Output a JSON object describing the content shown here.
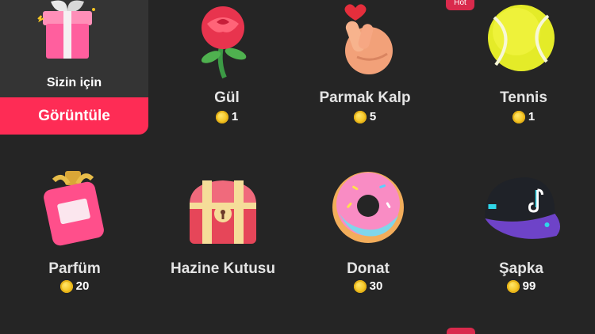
{
  "featured": {
    "caption": "Sizin için",
    "button_label": "Görüntüle"
  },
  "badges": {
    "hot": "Hot"
  },
  "gifts": [
    {
      "name": "Gül",
      "price": "1",
      "icon": "rose-icon"
    },
    {
      "name": "Parmak Kalp",
      "price": "5",
      "icon": "finger-heart-icon"
    },
    {
      "name": "Tennis",
      "price": "1",
      "icon": "tennis-ball-icon"
    },
    {
      "name": "Parfüm",
      "price": "20",
      "icon": "perfume-icon"
    },
    {
      "name": "Hazine Kutusu",
      "price": "",
      "icon": "treasure-chest-icon"
    },
    {
      "name": "Donat",
      "price": "30",
      "icon": "donut-icon"
    },
    {
      "name": "Şapka",
      "price": "99",
      "icon": "cap-icon"
    }
  ],
  "colors": {
    "background": "#252525",
    "accent": "#fe2c55",
    "coin": "#f4c524"
  }
}
